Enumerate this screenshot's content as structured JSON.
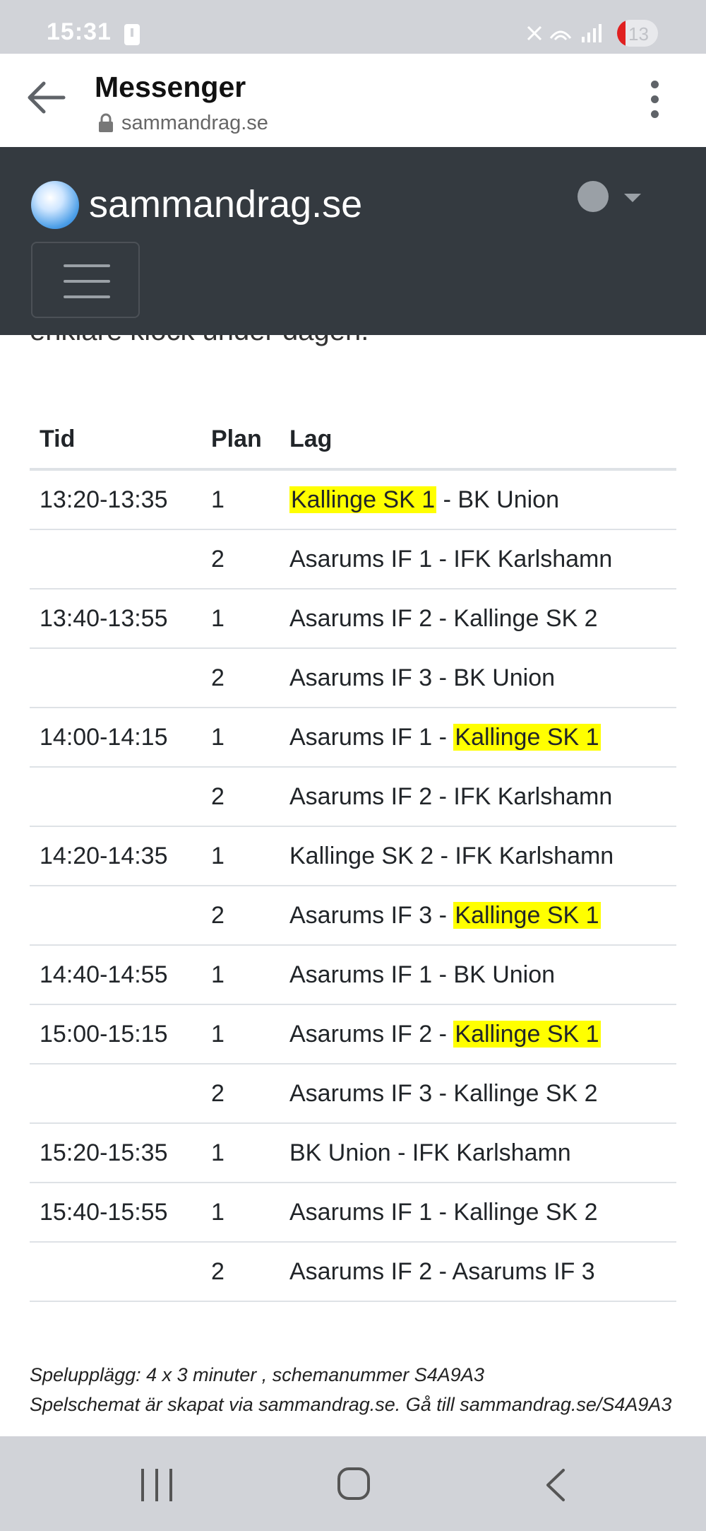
{
  "status_bar": {
    "time": "15:31",
    "battery_level": "13"
  },
  "app_bar": {
    "title": "Messenger",
    "url": "sammandrag.se"
  },
  "site": {
    "brand": "sammandrag.se",
    "partial_text": "enklare klock under dagen."
  },
  "table": {
    "headers": {
      "time": "Tid",
      "plan": "Plan",
      "team": "Lag"
    },
    "rows": [
      {
        "time": "13:20-13:35",
        "plan": "1",
        "home": "Kallinge SK 1",
        "sep": " - ",
        "away": "BK Union"
      },
      {
        "time": "",
        "plan": "2",
        "home": "Asarums IF 1",
        "sep": " - ",
        "away": "IFK Karlshamn"
      },
      {
        "time": "13:40-13:55",
        "plan": "1",
        "home": "Asarums IF 2",
        "sep": " - ",
        "away": "Kallinge SK 2"
      },
      {
        "time": "",
        "plan": "2",
        "home": "Asarums IF 3",
        "sep": " - ",
        "away": "BK Union"
      },
      {
        "time": "14:00-14:15",
        "plan": "1",
        "home": "Asarums IF 1",
        "sep": " - ",
        "away": "Kallinge SK 1"
      },
      {
        "time": "",
        "plan": "2",
        "home": "Asarums IF 2",
        "sep": " - ",
        "away": "IFK Karlshamn"
      },
      {
        "time": "14:20-14:35",
        "plan": "1",
        "home": "Kallinge SK 2",
        "sep": " - ",
        "away": "IFK Karlshamn"
      },
      {
        "time": "",
        "plan": "2",
        "home": "Asarums IF 3",
        "sep": " - ",
        "away": "Kallinge SK 1"
      },
      {
        "time": "14:40-14:55",
        "plan": "1",
        "home": "Asarums IF 1",
        "sep": " - ",
        "away": "BK Union"
      },
      {
        "time": "15:00-15:15",
        "plan": "1",
        "home": "Asarums IF 2",
        "sep": " - ",
        "away": "Kallinge SK 1"
      },
      {
        "time": "",
        "plan": "2",
        "home": "Asarums IF 3",
        "sep": " - ",
        "away": "Kallinge SK 2"
      },
      {
        "time": "15:20-15:35",
        "plan": "1",
        "home": "BK Union",
        "sep": " - ",
        "away": "IFK Karlshamn"
      },
      {
        "time": "15:40-15:55",
        "plan": "1",
        "home": "Asarums IF 1",
        "sep": " - ",
        "away": "Kallinge SK 2"
      },
      {
        "time": "",
        "plan": "2",
        "home": "Asarums IF 2",
        "sep": " - ",
        "away": "Asarums IF 3"
      }
    ],
    "highlighted_team": "Kallinge SK 1",
    "highlight_color": "#ffff00"
  },
  "footer": {
    "line1": "Spelupplägg: 4 x 3 minuter , schemanummer S4A9A3",
    "line2": "Spelschemat är skapat via sammandrag.se. Gå till sammandrag.se/S4A9A3"
  },
  "colors": {
    "navbar": "#343a40",
    "statusbar": "#d1d3d8",
    "border": "#dee2e6"
  },
  "icons": [
    "back-arrow-icon",
    "lock-icon",
    "more-vert-icon",
    "logo-icon",
    "globe-icon",
    "caret-down-icon",
    "hamburger-icon",
    "recent-apps-icon",
    "home-icon",
    "back-icon"
  ]
}
